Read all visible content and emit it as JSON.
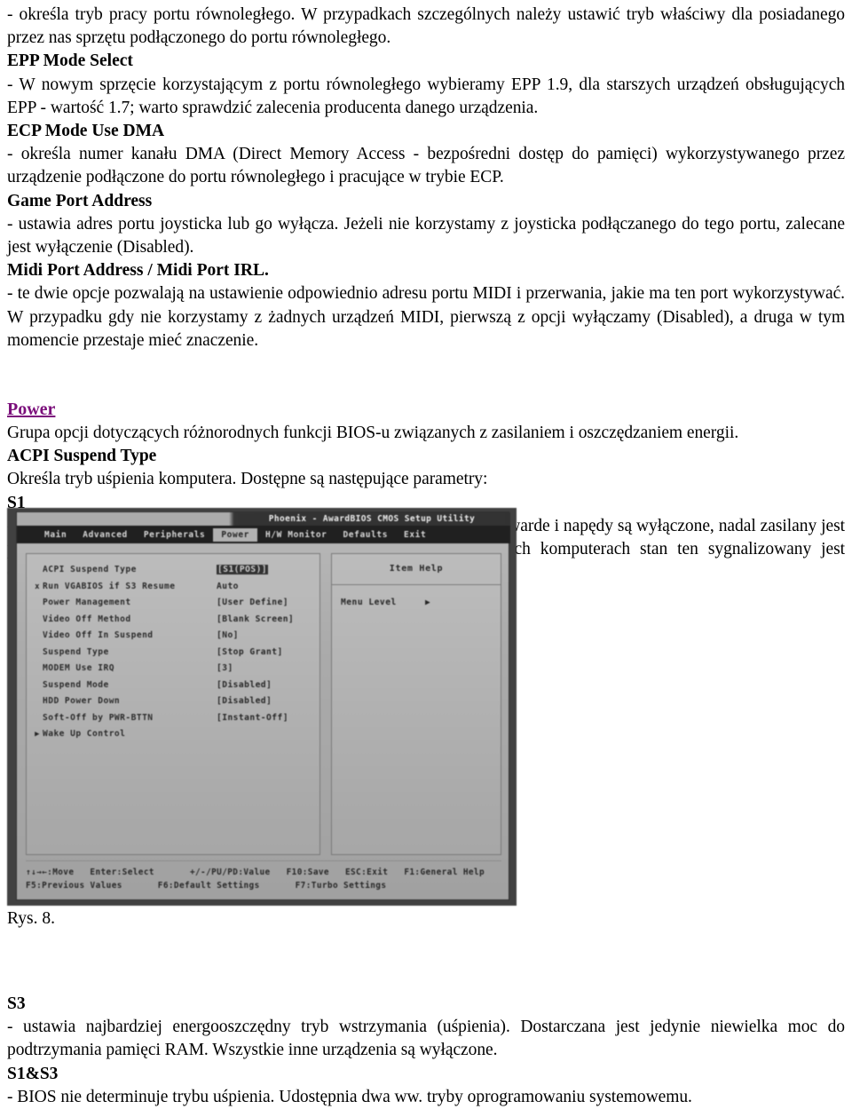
{
  "document": {
    "top_blocks": [
      {
        "type": "paragraph",
        "text": "- określa tryb pracy portu równoległego. W przypadkach szczególnych należy ustawić tryb właściwy dla posiadanego przez nas sprzętu podłączonego do portu równoległego."
      },
      {
        "type": "heading",
        "text": "EPP Mode Select"
      },
      {
        "type": "paragraph",
        "text": "- W nowym sprzęcie korzystającym z portu równoległego wybieramy EPP 1.9, dla starszych urządzeń obsługujących EPP - wartość 1.7; warto sprawdzić zalecenia producenta danego urządzenia."
      },
      {
        "type": "heading",
        "text": "ECP Mode Use DMA"
      },
      {
        "type": "paragraph",
        "text": "- określa numer kanału DMA (Direct Memory Access - bezpośredni dostęp do pamięci) wykorzystywanego przez urządzenie podłączone do portu równoległego i pracujące w trybie ECP."
      },
      {
        "type": "heading",
        "text": "Game Port Address"
      },
      {
        "type": "paragraph",
        "text": "- ustawia adres portu joysticka lub go wyłącza. Jeżeli nie korzystamy z joysticka podłączanego do tego portu, zalecane jest wyłączenie (Disabled)."
      },
      {
        "type": "heading",
        "text": "Midi Port Address / Midi Port IRL."
      },
      {
        "type": "paragraph",
        "text": "- te dwie opcje pozwalają na ustawienie odpowiednio adresu portu MIDI i przerwania, jakie ma ten port wykorzystywać. W przypadku gdy nie korzystamy z żadnych urządzeń MIDI, pierwszą z opcji wyłączamy (Disabled), a druga w tym momencie przestaje mieć znaczenie."
      }
    ],
    "section_link": "Power",
    "mid_blocks": [
      {
        "type": "paragraph",
        "text": "Grupa opcji dotyczących różnorodnych funkcji BIOS-u związanych z zasilaniem i oszczędzaniem energii."
      },
      {
        "type": "heading",
        "text": "ACPI Suspend Type"
      },
      {
        "type": "paragraph",
        "text": "Określa tryb uśpienia komputera. Dostępne są następujące parametry:"
      },
      {
        "type": "heading",
        "text": "S1"
      },
      {
        "type": "paragraph",
        "text": "- ustawia tryb uśpienia charakteryzujący się tym, że monitor oraz dyski twarde i napędy są wyłączone, nadal zasilany jest procesor, pamięć podręczna, wentylatory, pamięć RAM. W niektórych komputerach stan ten sygnalizowany jest odpowiednio oznakowaną diodą na obudowie."
      }
    ],
    "figure_caption": "Rys. 8.",
    "tail_blocks": [
      {
        "type": "heading",
        "text": "S3"
      },
      {
        "type": "paragraph",
        "text": "- ustawia najbardziej energooszczędny tryb wstrzymania (uśpienia). Dostarczana jest jedynie niewielka moc do podtrzymania pamięci RAM. Wszystkie inne urządzenia są wyłączone."
      },
      {
        "type": "heading",
        "text": "S1&S3"
      },
      {
        "type": "paragraph",
        "text": "- BIOS nie determinuje trybu uśpienia. Udostępnia dwa ww. tryby oprogramowaniu systemowemu."
      }
    ]
  },
  "bios": {
    "title": "Phoenix - AwardBIOS CMOS Setup Utility",
    "tabs": [
      {
        "label": "Main",
        "active": false
      },
      {
        "label": "Advanced",
        "active": false
      },
      {
        "label": "Peripherals",
        "active": false
      },
      {
        "label": "Power",
        "active": true
      },
      {
        "label": "H/W Monitor",
        "active": false
      },
      {
        "label": "Defaults",
        "active": false
      },
      {
        "label": "Exit",
        "active": false
      }
    ],
    "rows": [
      {
        "marker": "",
        "label": "ACPI Suspend Type",
        "value": "[S1(POS)]",
        "highlight": true
      },
      {
        "marker": "x",
        "label": "Run VGABIOS if S3 Resume",
        "value": "Auto",
        "highlight": false
      },
      {
        "marker": "",
        "label": "Power Management",
        "value": "[User Define]",
        "highlight": false
      },
      {
        "marker": "",
        "label": "Video Off Method",
        "value": "[Blank Screen]",
        "highlight": false
      },
      {
        "marker": "",
        "label": "Video Off In Suspend",
        "value": "[No]",
        "highlight": false
      },
      {
        "marker": "",
        "label": "Suspend Type",
        "value": "[Stop Grant]",
        "highlight": false
      },
      {
        "marker": "",
        "label": "MODEM Use IRQ",
        "value": "[3]",
        "highlight": false
      },
      {
        "marker": "",
        "label": "Suspend Mode",
        "value": "[Disabled]",
        "highlight": false
      },
      {
        "marker": "",
        "label": "HDD Power Down",
        "value": "[Disabled]",
        "highlight": false
      },
      {
        "marker": "",
        "label": "Soft-Off by PWR-BTTN",
        "value": "[Instant-Off]",
        "highlight": false
      },
      {
        "marker": "▶",
        "label": "Wake Up Control",
        "value": "",
        "highlight": false
      }
    ],
    "help_title": "Item Help",
    "menu_level_label": "Menu Level",
    "menu_level_arrow": "▶",
    "footer": {
      "line1_a": "↑↓→←:Move",
      "line1_b": "Enter:Select",
      "line1_c": "+/-/PU/PD:Value",
      "line1_d": "F10:Save",
      "line1_e": "ESC:Exit",
      "line1_f": "F1:General Help",
      "line2_a": "F5:Previous Values",
      "line2_b": "F6:Default Settings",
      "line2_c": "F7:Turbo Settings"
    }
  }
}
